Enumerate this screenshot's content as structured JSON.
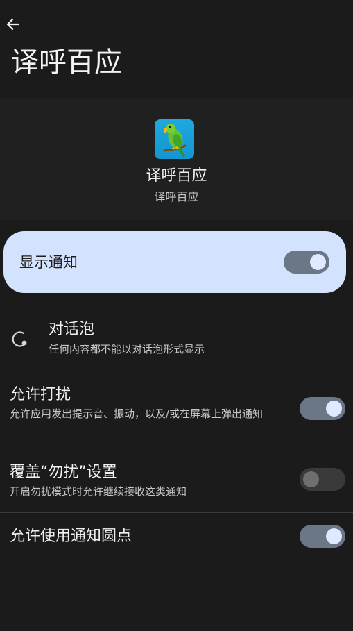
{
  "header": {
    "back_icon": "arrow-left-icon",
    "title": "译呼百应"
  },
  "app": {
    "icon": "parrot-app-icon",
    "name": "译呼百应",
    "subtitle": "译呼百应"
  },
  "show_notifications": {
    "label": "显示通知",
    "enabled": true
  },
  "settings": {
    "bubbles": {
      "icon": "bubble-icon",
      "title": "对话泡",
      "desc": "任何内容都不能以对话泡形式显示"
    },
    "allow_interrupt": {
      "title": "允许打扰",
      "desc": "允许应用发出提示音、振动，以及/或在屏幕上弹出通知",
      "enabled": true
    },
    "override_dnd": {
      "title": "覆盖“勿扰”设置",
      "desc": "开启勿扰模式时允许继续接收这类通知",
      "enabled": false
    },
    "notification_dot": {
      "title": "允许使用通知圆点",
      "enabled": true
    }
  },
  "colors": {
    "background": "#1b1b1b",
    "card_highlight": "#d3e3fd",
    "switch_on_track": "#6b7787",
    "switch_on_knob": "#dfe9ff",
    "switch_off_track": "#3a3a3a"
  }
}
